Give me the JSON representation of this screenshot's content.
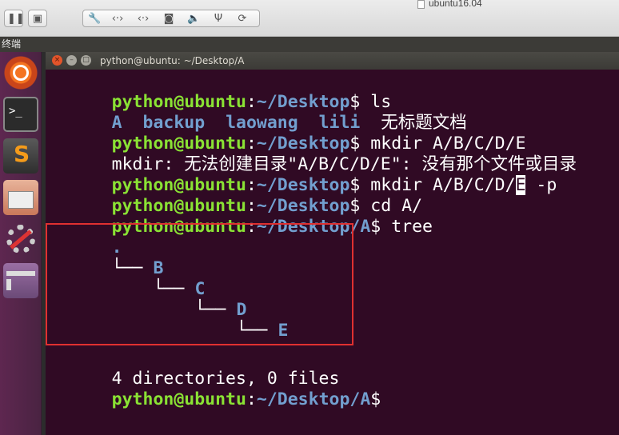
{
  "vm_window": {
    "title": "ubuntu16.04",
    "toolbar_icons": [
      "pause-icon",
      "screenshot-icon",
      "wrench-icon",
      "network-arrows-icon",
      "network-arrows-alt-icon",
      "disk-icon",
      "speaker-icon",
      "usb-icon",
      "sync-icon"
    ]
  },
  "panel": {
    "title": "终端"
  },
  "launcher": {
    "items": [
      "ubuntu-dash-icon",
      "terminal-icon",
      "sublime-text-icon",
      "file-cabinet-icon",
      "system-settings-icon",
      "workspace-switcher-icon"
    ]
  },
  "terminal": {
    "window_title": "python@ubuntu: ~/Desktop/A",
    "prompt_user": "python@ubuntu",
    "colon": ":",
    "prompt_path_desktop": "~/Desktop",
    "prompt_path_a": "~/Desktop/A",
    "dollar": "$",
    "cmd1": " ls",
    "ls_items": [
      "A",
      "backup",
      "laowang",
      "lili",
      "无标题文档"
    ],
    "cmd2": " mkdir A/B/C/D/E",
    "error_line": "mkdir: 无法创建目录\"A/B/C/D/E\": 没有那个文件或目录",
    "cmd3_prefix": " mkdir A/B/",
    "cmd3_mid": "C/D/",
    "cmd3_cursor": "E",
    "cmd3_suffix": " -p",
    "cmd4": " cd A/",
    "cmd5": " tree",
    "tree_root": ".",
    "tree_nodes": [
      {
        "branch": "└──",
        "name": "B"
      },
      {
        "branch": "└──",
        "name": "C"
      },
      {
        "branch": "└──",
        "name": "D"
      },
      {
        "branch": "└──",
        "name": "E"
      }
    ],
    "summary": "4 directories, 0 files"
  }
}
